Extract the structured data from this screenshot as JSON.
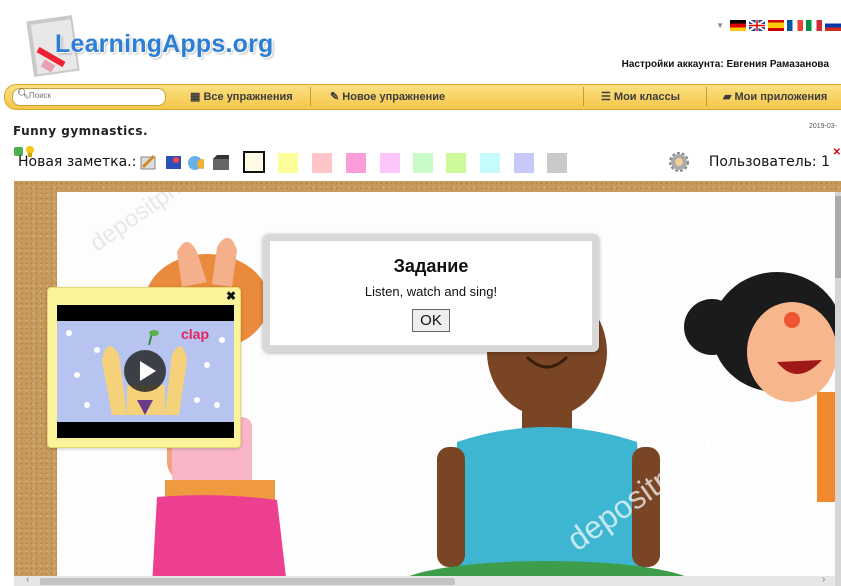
{
  "header": {
    "logo_text": "LearningApps.org",
    "account_text": "Настройки аккаунта: Евгения Рамазанова",
    "languages": [
      "de",
      "en",
      "es",
      "fr",
      "it",
      "ru"
    ]
  },
  "nav": {
    "search_placeholder": "Поиск",
    "items": [
      "Все упражнения",
      "Новое упражнение",
      "Мои классы",
      "Мои приложения"
    ]
  },
  "page": {
    "title": "Funny gymnastics.",
    "date": "2019-03-"
  },
  "toolbar": {
    "new_note_label": "Новая заметка.:",
    "user_label": "Пользователь: 1",
    "swatch_colors": [
      "#fdfbe6",
      "#fdfd9a",
      "#fdc5c8",
      "#fb9bd7",
      "#fdc5fb",
      "#c9fbc9",
      "#cdfb9a",
      "#c5fbfb",
      "#c7c9fb",
      "#c9c9c9"
    ]
  },
  "task_dialog": {
    "title": "Задание",
    "text": "Listen, watch and sing!",
    "ok_label": "OK"
  },
  "video_note": {
    "caption": "clap",
    "close": "✖"
  },
  "colors": {
    "nav_bg": "#f4c64a",
    "logo_blue": "#2d7fd6",
    "board_cork": "#c79a5e",
    "note_yellow": "#fbf39a"
  }
}
